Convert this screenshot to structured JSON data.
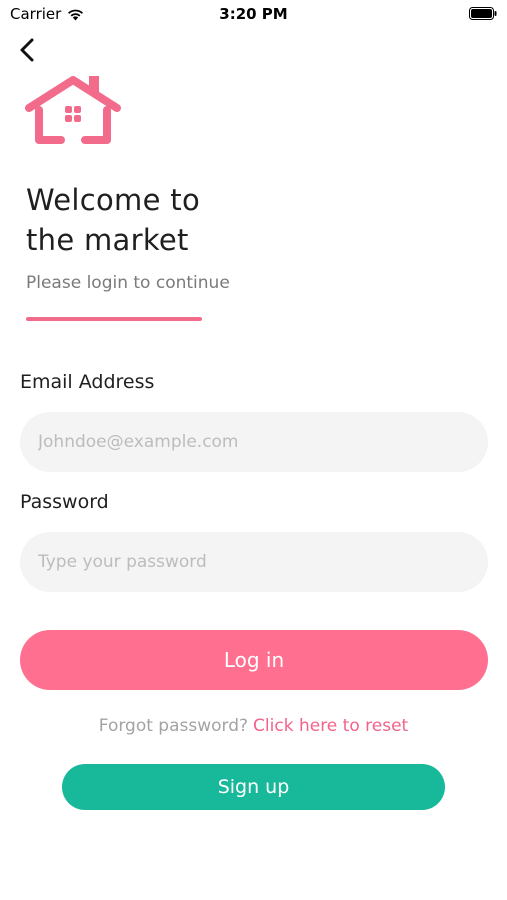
{
  "status_bar": {
    "carrier": "Carrier",
    "time": "3:20 PM"
  },
  "header": {
    "back_icon": "chevron-left-icon",
    "logo_icon": "house-icon"
  },
  "welcome": {
    "line1": "Welcome to",
    "line2": "the market",
    "subtitle": "Please login to continue"
  },
  "form": {
    "email_label": "Email Address",
    "email_placeholder": "Johndoe@example.com",
    "email_value": "",
    "password_label": "Password",
    "password_placeholder": "Type your password",
    "password_value": ""
  },
  "actions": {
    "login_label": "Log in",
    "forgot_text": "Forgot password?",
    "reset_link": "Click here to reset",
    "signup_label": "Sign up"
  },
  "colors": {
    "accent_pink": "#ff6f8f",
    "link_pink": "#f4628a",
    "signup_teal": "#18b89a",
    "input_bg": "#f4f4f4"
  }
}
